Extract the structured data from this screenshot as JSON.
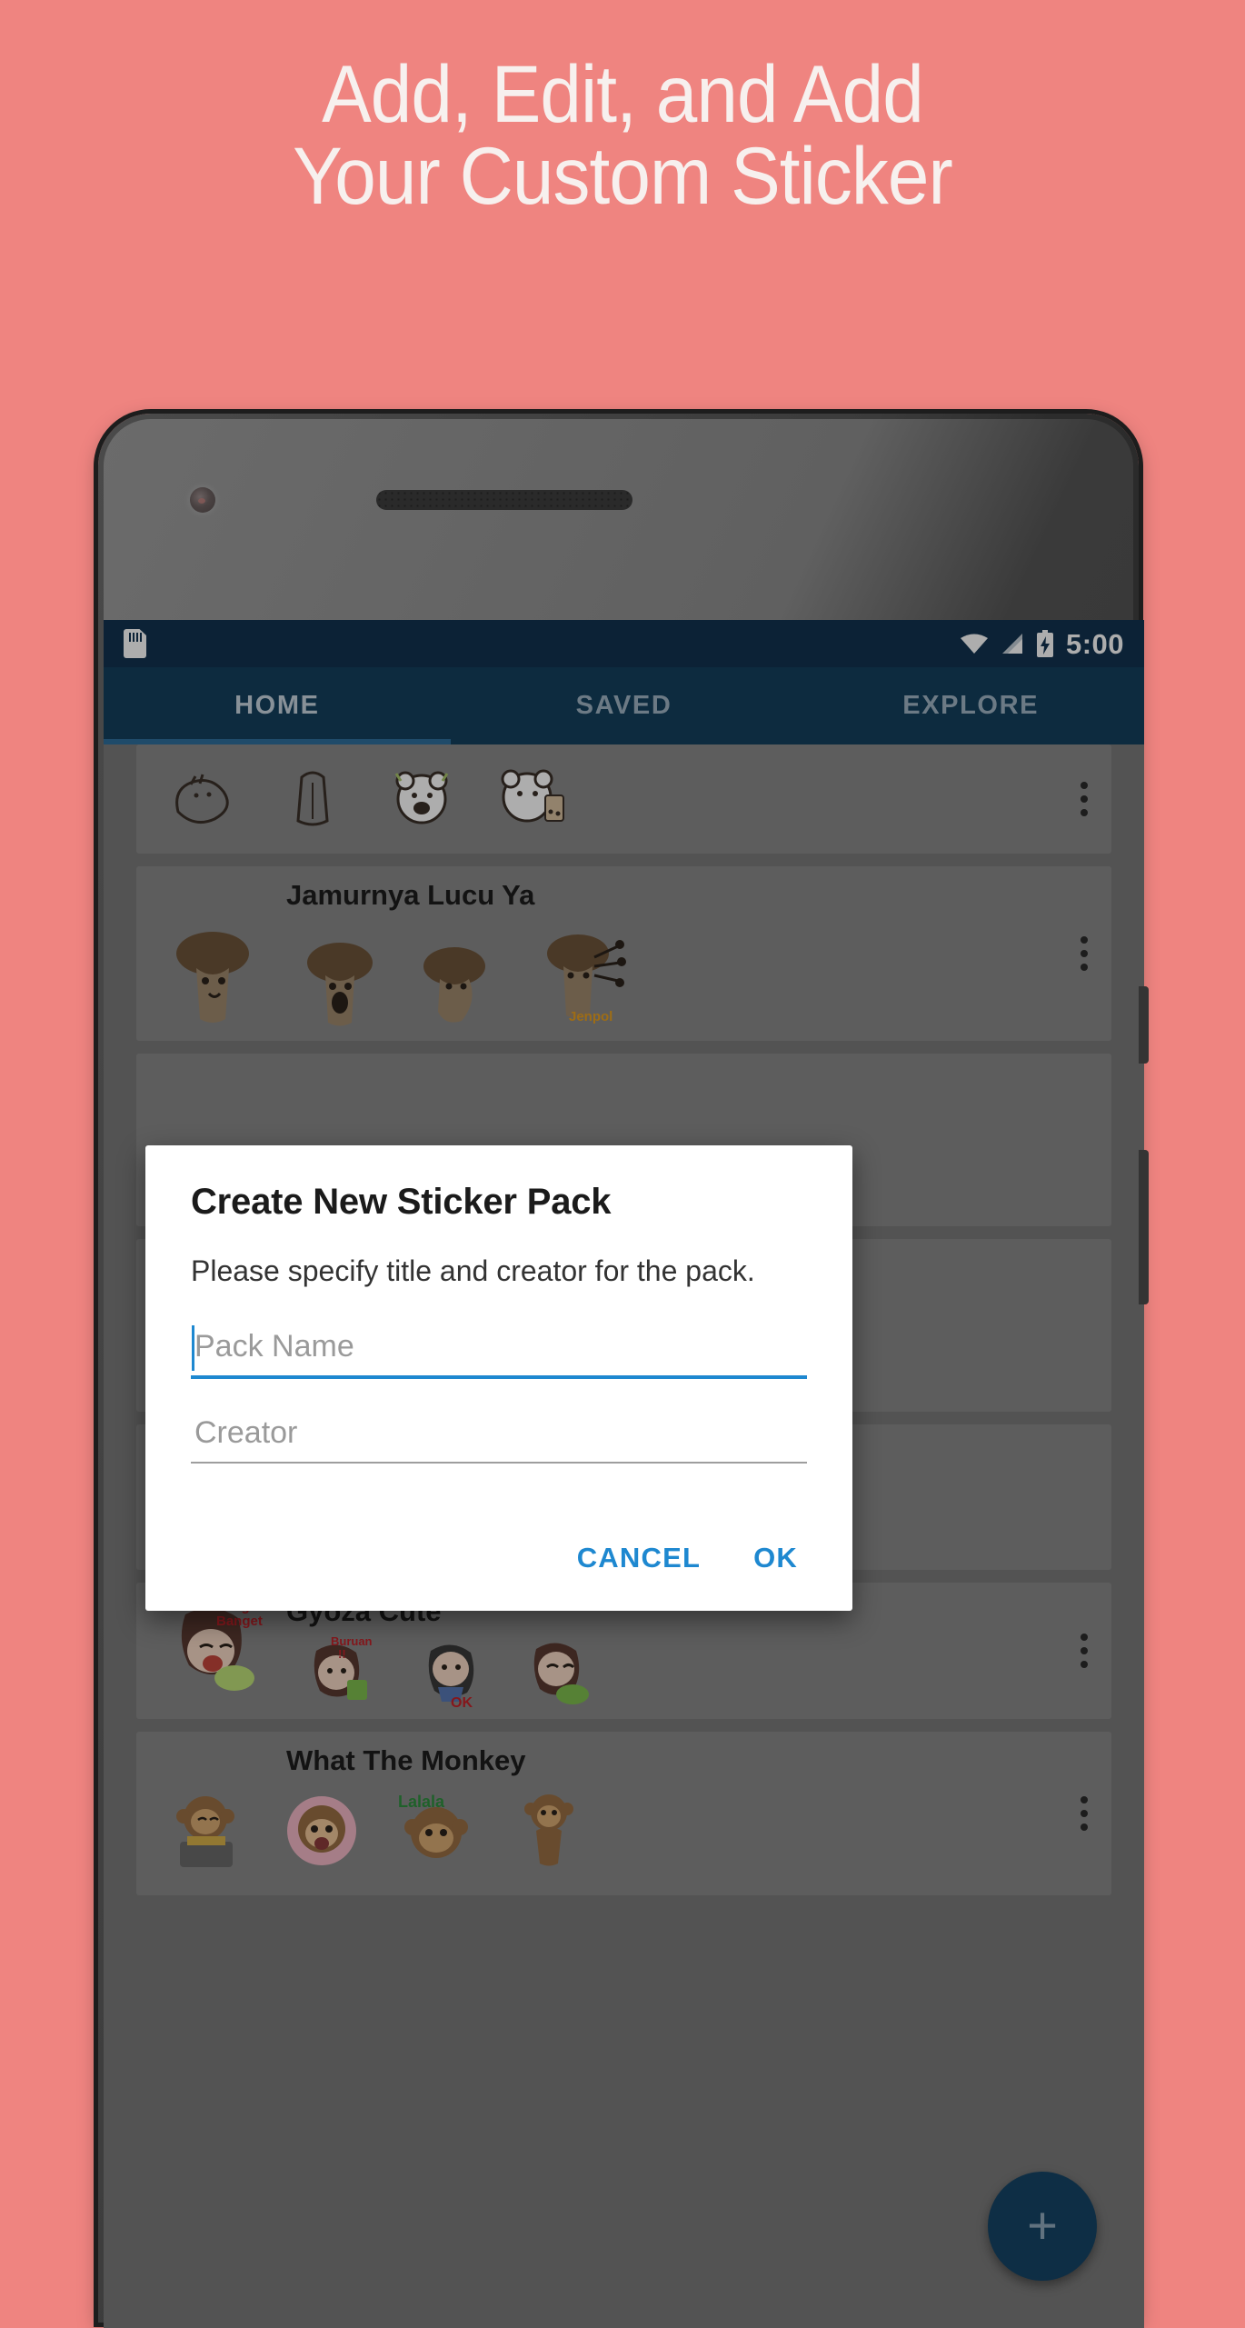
{
  "promo": {
    "headline_line1": "Add, Edit, and Add",
    "headline_line2": "Your Custom Sticker",
    "background_color": "#ef8480",
    "text_color": "#f7f0ee"
  },
  "status_bar": {
    "sd_card_icon": "sd-card-icon",
    "wifi_icon": "wifi-icon",
    "signal_icon": "cellular-signal-icon",
    "battery_icon": "battery-charging-icon",
    "time": "5:00",
    "background_color": "#133350"
  },
  "tabs": {
    "items": [
      {
        "label": "HOME",
        "active": true
      },
      {
        "label": "SAVED",
        "active": false
      },
      {
        "label": "EXPLORE",
        "active": false
      }
    ],
    "background_color": "#14405e",
    "indicator_color": "#2e6f9c"
  },
  "sticker_packs": [
    {
      "title": "",
      "overflow_icon": "more-vertical-icon"
    },
    {
      "title": "Jamurnya Lucu Ya",
      "overflow_icon": "more-vertical-icon"
    },
    {
      "title": "Gyoza Cute",
      "overflow_icon": "more-vertical-icon"
    },
    {
      "title": "What The Monkey",
      "overflow_icon": "more-vertical-icon"
    }
  ],
  "fab": {
    "label": "+",
    "name": "add-sticker-pack-fab",
    "color": "#154566"
  },
  "dialog": {
    "title": "Create New Sticker Pack",
    "message": "Please specify title and creator for the pack.",
    "fields": [
      {
        "name": "pack-name-input",
        "placeholder": "Pack Name",
        "value": "",
        "focused": true
      },
      {
        "name": "creator-input",
        "placeholder": "Creator",
        "value": "",
        "focused": false
      }
    ],
    "cancel_label": "CANCEL",
    "ok_label": "OK",
    "accent_color": "#1e88d0"
  }
}
